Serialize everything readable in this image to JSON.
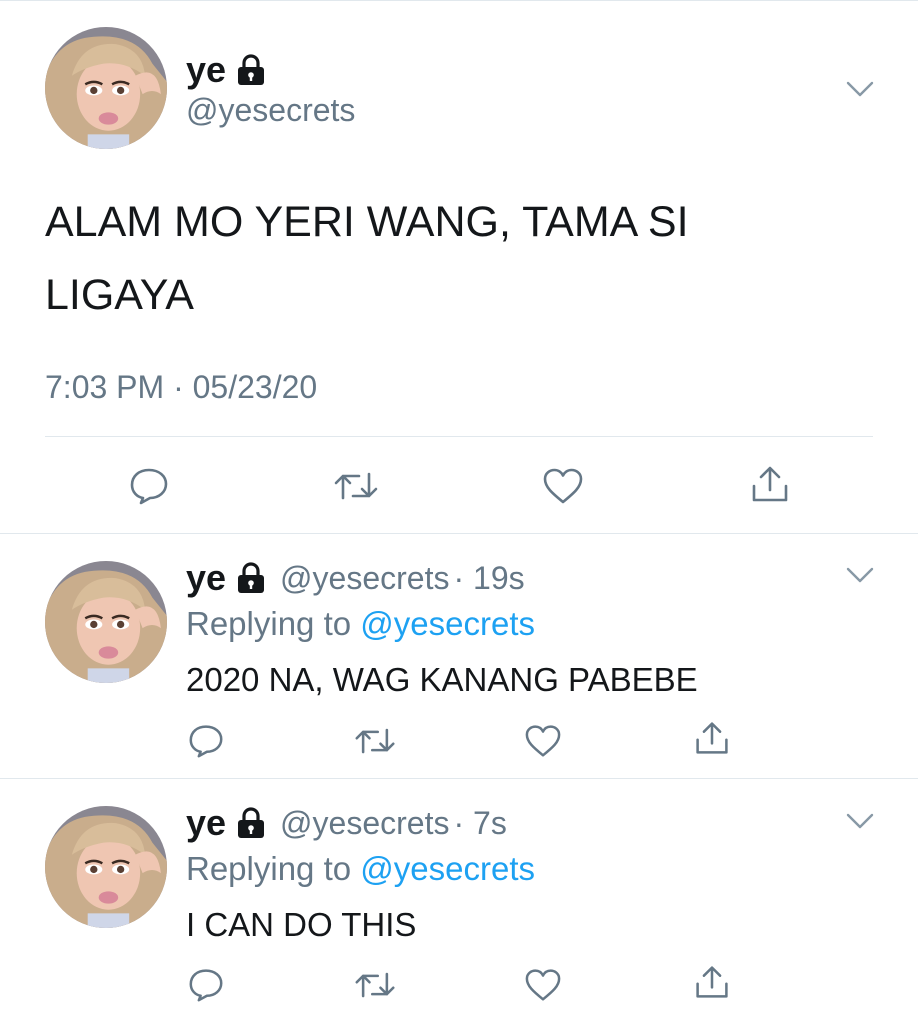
{
  "tweet": {
    "author_name": "ye",
    "author_handle": "@yesecrets",
    "text": "ALAM MO YERI WANG, TAMA SI LIGAYA",
    "timestamp": "7:03 PM · 05/23/20"
  },
  "replies": [
    {
      "author_name": "ye",
      "author_handle": "@yesecrets",
      "time": "· 19s",
      "replying_prefix": "Replying to",
      "replying_to": "@yesecrets",
      "text": "2020 NA, WAG KANANG PABEBE"
    },
    {
      "author_name": "ye",
      "author_handle": "@yesecrets",
      "time": "· 7s",
      "replying_prefix": "Replying to",
      "replying_to": "@yesecrets",
      "text": "I CAN DO THIS"
    }
  ],
  "colors": {
    "text": "#14171a",
    "secondary": "#657786",
    "accent": "#1da1f2",
    "divider": "#e1e8ed"
  },
  "icons": [
    "lock-icon",
    "chevron-down-icon",
    "reply-icon",
    "retweet-icon",
    "like-icon",
    "share-icon"
  ]
}
